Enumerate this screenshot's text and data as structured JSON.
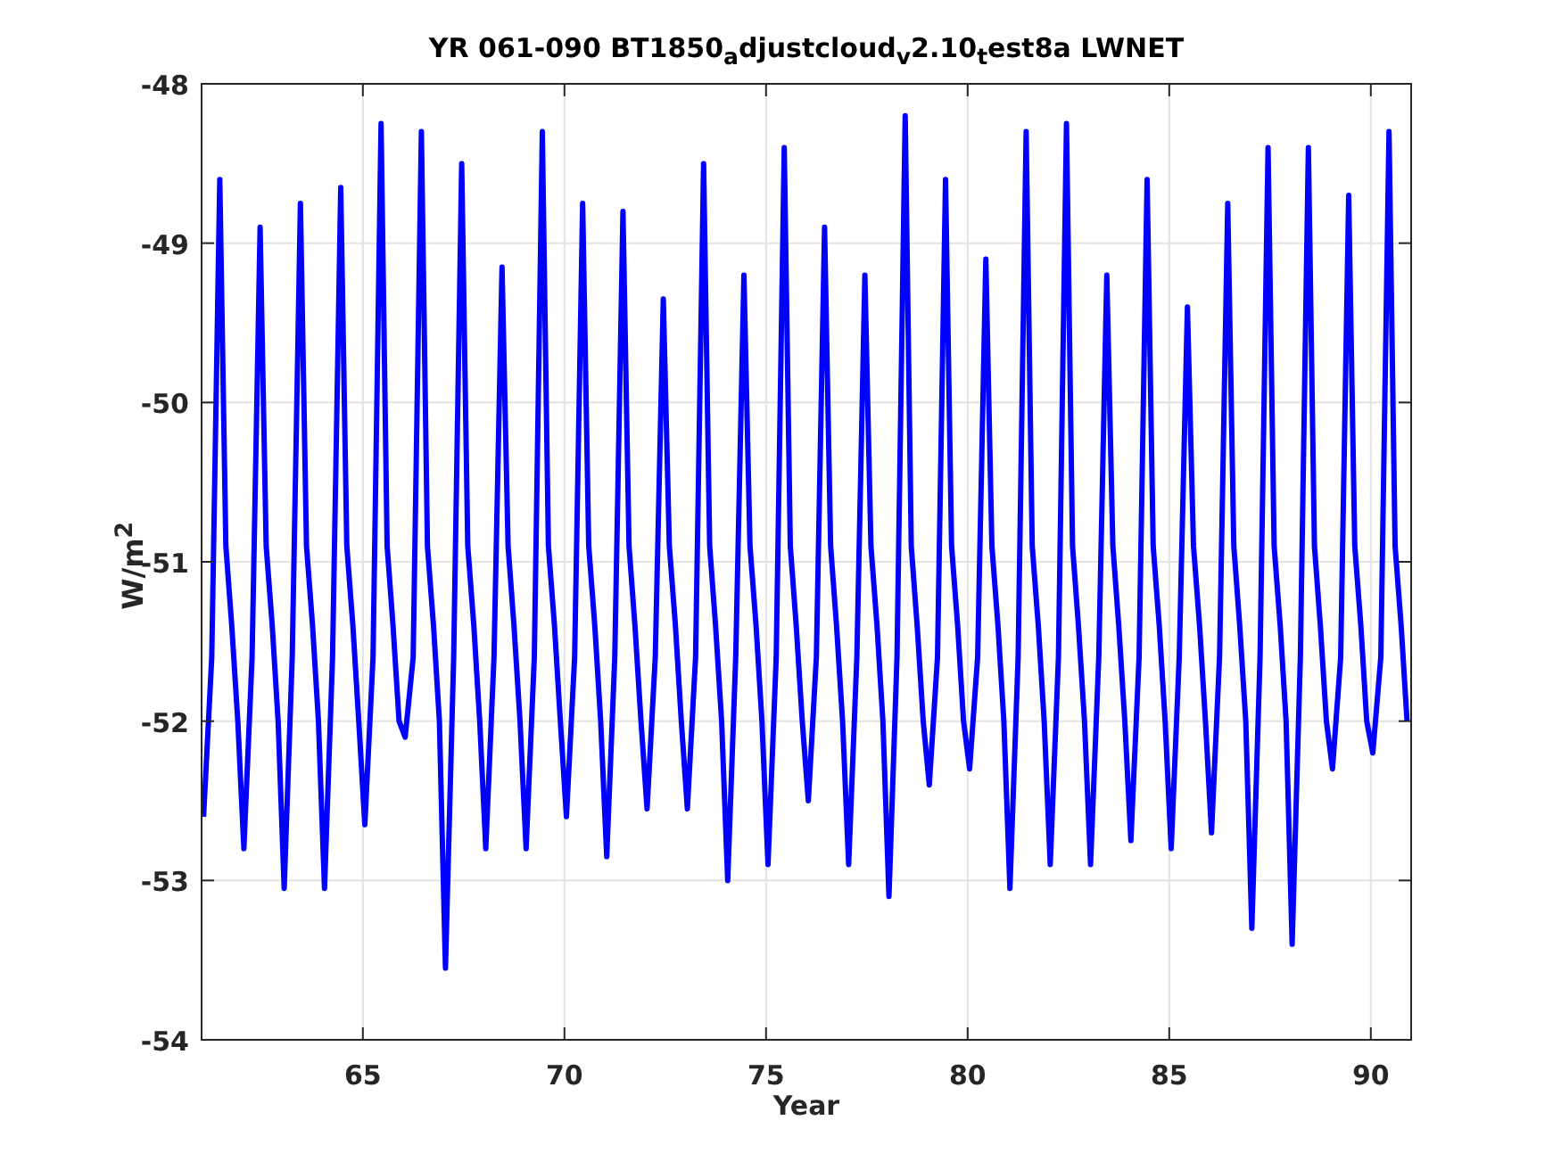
{
  "figure": {
    "chart_data": {
      "type": "line",
      "title": "YR 061-090 BT1850$_{a}$djustcloud$_{v}$2.10$_{t}$est8a LWNET",
      "xlabel": "Year",
      "ylabel": "W/m$^{2}$",
      "xlim": [
        61,
        91
      ],
      "ylim": [
        -54,
        -48
      ],
      "xticks": [
        65,
        70,
        75,
        80,
        85,
        90
      ],
      "yticks": [
        -54,
        -53,
        -52,
        -51,
        -50,
        -49,
        -48
      ],
      "grid": true,
      "x": [
        61.05,
        61.25,
        61.45,
        61.6,
        61.75,
        61.9,
        62.05,
        62.25,
        62.45,
        62.6,
        62.75,
        62.9,
        63.05,
        63.25,
        63.45,
        63.6,
        63.75,
        63.9,
        64.05,
        64.25,
        64.45,
        64.6,
        64.75,
        64.9,
        65.05,
        65.25,
        65.45,
        65.6,
        65.75,
        65.9,
        66.05,
        66.25,
        66.45,
        66.6,
        66.75,
        66.9,
        67.05,
        67.25,
        67.45,
        67.6,
        67.75,
        67.9,
        68.05,
        68.25,
        68.45,
        68.6,
        68.75,
        68.9,
        69.05,
        69.25,
        69.45,
        69.6,
        69.75,
        69.9,
        70.05,
        70.25,
        70.45,
        70.6,
        70.75,
        70.9,
        71.05,
        71.25,
        71.45,
        71.6,
        71.75,
        71.9,
        72.05,
        72.25,
        72.45,
        72.6,
        72.75,
        72.9,
        73.05,
        73.25,
        73.45,
        73.6,
        73.75,
        73.9,
        74.05,
        74.25,
        74.45,
        74.6,
        74.75,
        74.9,
        75.05,
        75.25,
        75.45,
        75.6,
        75.75,
        75.9,
        76.05,
        76.25,
        76.45,
        76.6,
        76.75,
        76.9,
        77.05,
        77.25,
        77.45,
        77.6,
        77.75,
        77.9,
        78.05,
        78.25,
        78.45,
        78.6,
        78.75,
        78.9,
        79.05,
        79.25,
        79.45,
        79.6,
        79.75,
        79.9,
        80.05,
        80.25,
        80.45,
        80.6,
        80.75,
        80.9,
        81.05,
        81.25,
        81.45,
        81.6,
        81.75,
        81.9,
        82.05,
        82.25,
        82.45,
        82.6,
        82.75,
        82.9,
        83.05,
        83.25,
        83.45,
        83.6,
        83.75,
        83.9,
        84.05,
        84.25,
        84.45,
        84.6,
        84.75,
        84.9,
        85.05,
        85.25,
        85.45,
        85.6,
        85.75,
        85.9,
        86.05,
        86.25,
        86.45,
        86.6,
        86.75,
        86.9,
        87.05,
        87.25,
        87.45,
        87.6,
        87.75,
        87.9,
        88.05,
        88.25,
        88.45,
        88.6,
        88.75,
        88.9,
        89.05,
        89.25,
        89.45,
        89.6,
        89.75,
        89.9,
        90.05,
        90.25,
        90.45,
        90.6,
        90.75,
        90.9
      ],
      "series": [
        {
          "color": "#0000ff",
          "values": [
            -52.6,
            -51.6,
            -48.6,
            -50.9,
            -51.4,
            -52.0,
            -52.8,
            -51.6,
            -48.9,
            -50.9,
            -51.4,
            -52.0,
            -53.05,
            -51.6,
            -48.75,
            -50.9,
            -51.4,
            -52.0,
            -53.05,
            -51.6,
            -48.65,
            -50.9,
            -51.4,
            -52.0,
            -52.65,
            -51.6,
            -48.25,
            -50.9,
            -51.4,
            -52.0,
            -52.1,
            -51.6,
            -48.3,
            -50.9,
            -51.4,
            -52.0,
            -53.55,
            -51.6,
            -48.5,
            -50.9,
            -51.4,
            -52.0,
            -52.8,
            -51.6,
            -49.15,
            -50.9,
            -51.4,
            -52.0,
            -52.8,
            -51.6,
            -48.3,
            -50.9,
            -51.4,
            -52.0,
            -52.6,
            -51.6,
            -48.75,
            -50.9,
            -51.4,
            -52.0,
            -52.85,
            -51.6,
            -48.8,
            -50.9,
            -51.4,
            -52.0,
            -52.55,
            -51.6,
            -49.35,
            -50.9,
            -51.4,
            -52.0,
            -52.55,
            -51.6,
            -48.5,
            -50.9,
            -51.4,
            -52.0,
            -53.0,
            -51.6,
            -49.2,
            -50.9,
            -51.4,
            -52.0,
            -52.9,
            -51.6,
            -48.4,
            -50.9,
            -51.4,
            -52.0,
            -52.5,
            -51.6,
            -48.9,
            -50.9,
            -51.4,
            -52.0,
            -52.9,
            -51.6,
            -49.2,
            -50.9,
            -51.4,
            -52.0,
            -53.1,
            -51.6,
            -48.2,
            -50.9,
            -51.4,
            -52.0,
            -52.4,
            -51.6,
            -48.6,
            -50.9,
            -51.4,
            -52.0,
            -52.3,
            -51.6,
            -49.1,
            -50.9,
            -51.4,
            -52.0,
            -53.05,
            -51.6,
            -48.3,
            -50.9,
            -51.4,
            -52.0,
            -52.9,
            -51.6,
            -48.25,
            -50.9,
            -51.4,
            -52.0,
            -52.9,
            -51.6,
            -49.2,
            -50.9,
            -51.4,
            -52.0,
            -52.75,
            -51.6,
            -48.6,
            -50.9,
            -51.4,
            -52.0,
            -52.8,
            -51.6,
            -49.4,
            -50.9,
            -51.4,
            -52.0,
            -52.7,
            -51.6,
            -48.75,
            -50.9,
            -51.4,
            -52.0,
            -53.3,
            -51.6,
            -48.4,
            -50.9,
            -51.4,
            -52.0,
            -53.4,
            -51.6,
            -48.4,
            -50.9,
            -51.4,
            -52.0,
            -52.3,
            -51.6,
            -48.7,
            -50.9,
            -51.4,
            -52.0,
            -52.2,
            -51.6,
            -48.3,
            -50.9,
            -51.4,
            -52.0
          ]
        }
      ]
    }
  }
}
